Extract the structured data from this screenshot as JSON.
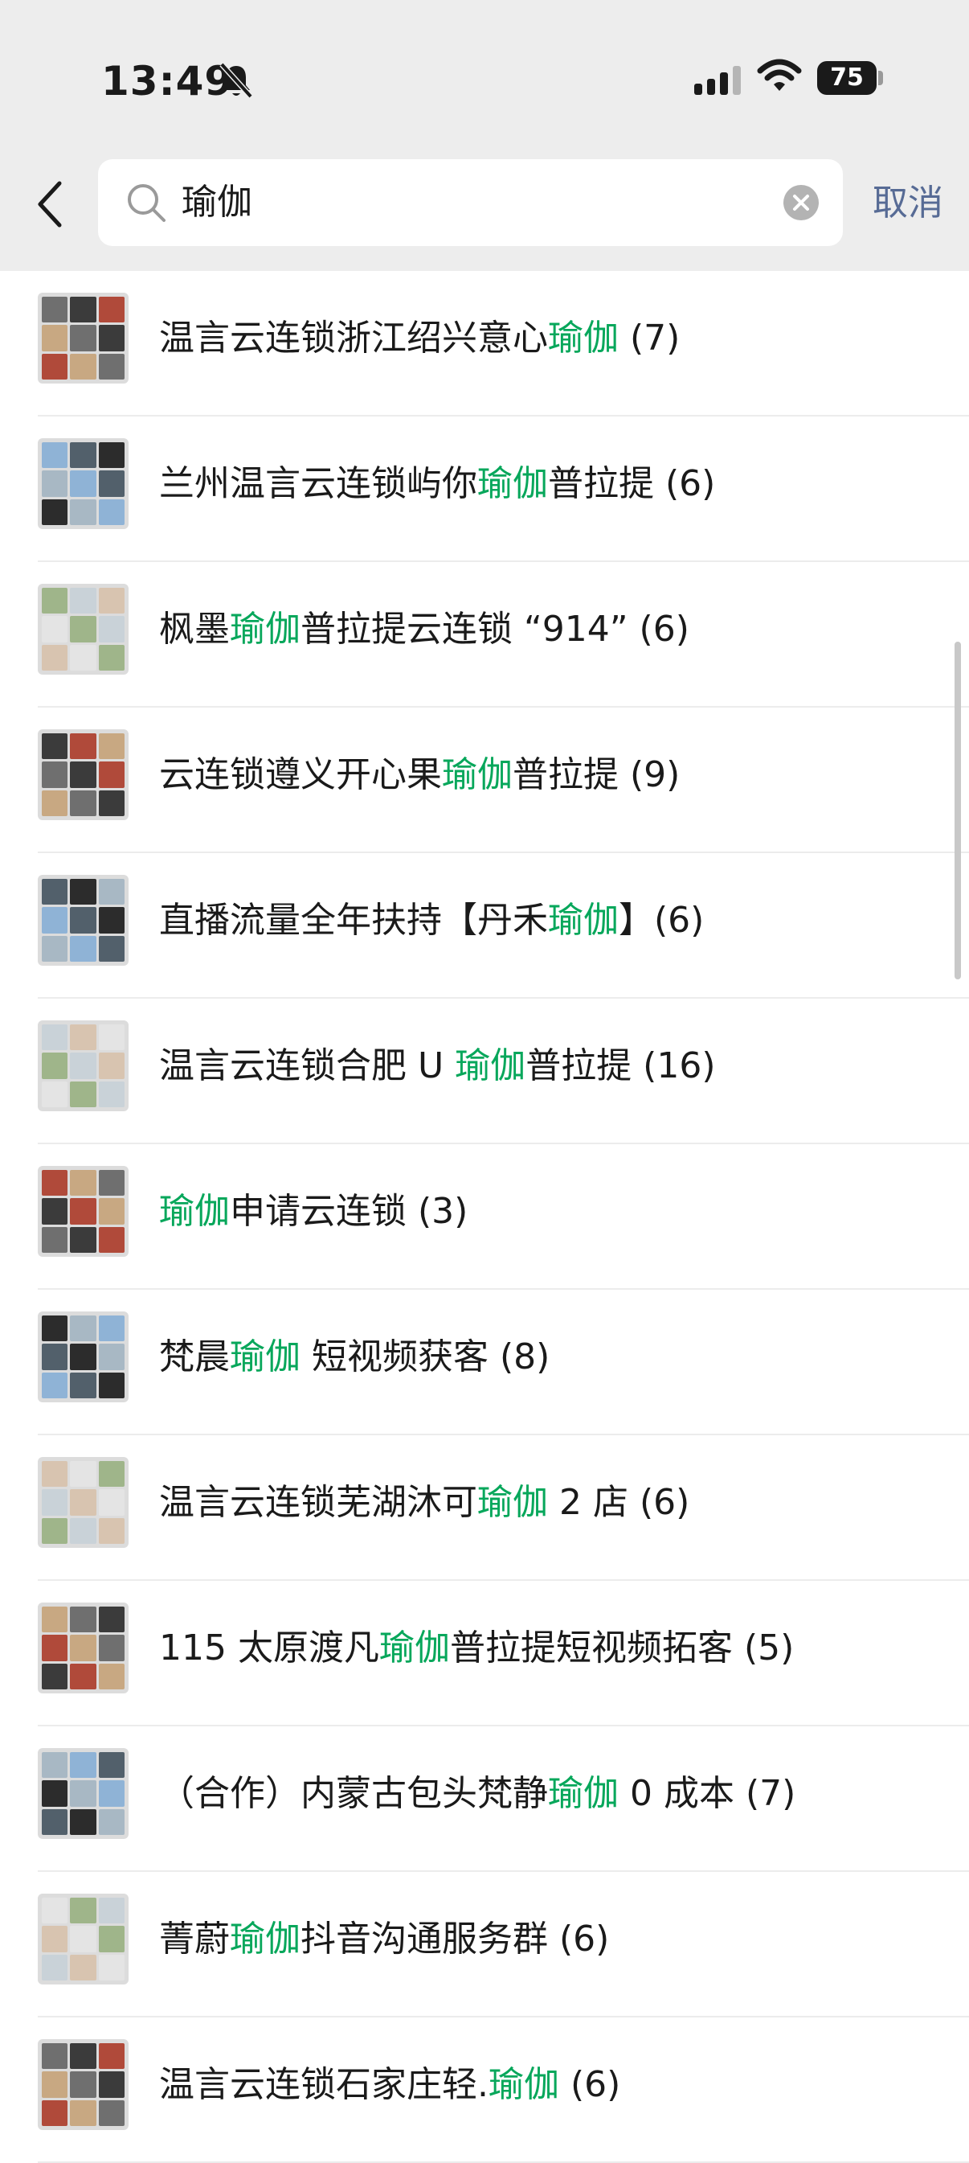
{
  "status_bar": {
    "time": "13:49",
    "battery": "75",
    "icons": [
      "bell-slash-icon",
      "signal-icon",
      "wifi-icon",
      "battery-icon"
    ]
  },
  "header": {
    "back_icon": "chevron-left-icon",
    "search": {
      "value": "瑜伽",
      "search_icon": "search-icon",
      "clear_icon": "clear-icon"
    },
    "cancel_label": "取消"
  },
  "colors": {
    "highlight": "#07a75b",
    "cancel": "#576b95",
    "header_bg": "#ededed"
  },
  "results": [
    {
      "before": "温言云连锁浙江绍兴意心",
      "match": "瑜伽",
      "after": " (7)"
    },
    {
      "before": "兰州温言云连锁屿你",
      "match": "瑜伽",
      "after": "普拉提 (6)"
    },
    {
      "before": "枫墨",
      "match": "瑜伽",
      "after": "普拉提云连锁 “914” (6)"
    },
    {
      "before": "云连锁遵义开心果",
      "match": "瑜伽",
      "after": "普拉提 (9)"
    },
    {
      "before": "直播流量全年扶持【丹禾",
      "match": "瑜伽",
      "after": "】(6)"
    },
    {
      "before": "温言云连锁合肥 U ",
      "match": "瑜伽",
      "after": "普拉提 (16)"
    },
    {
      "before": "",
      "match": "瑜伽",
      "after": "申请云连锁 (3)"
    },
    {
      "before": "梵晨",
      "match": "瑜伽",
      "after": " 短视频获客 (8)"
    },
    {
      "before": "温言云连锁芜湖沐可",
      "match": "瑜伽",
      "after": " 2 店 (6)"
    },
    {
      "before": "115 太原渡凡",
      "match": "瑜伽",
      "after": "普拉提短视频拓客 (5)"
    },
    {
      "before": "（合作）内蒙古包头梵静",
      "match": "瑜伽",
      "after": " 0 成本 (7)"
    },
    {
      "before": "菁蔚",
      "match": "瑜伽",
      "after": "抖音沟通服务群 (6)"
    },
    {
      "before": "温言云连锁石家庄轻.",
      "match": "瑜伽",
      "after": " (6)"
    }
  ]
}
